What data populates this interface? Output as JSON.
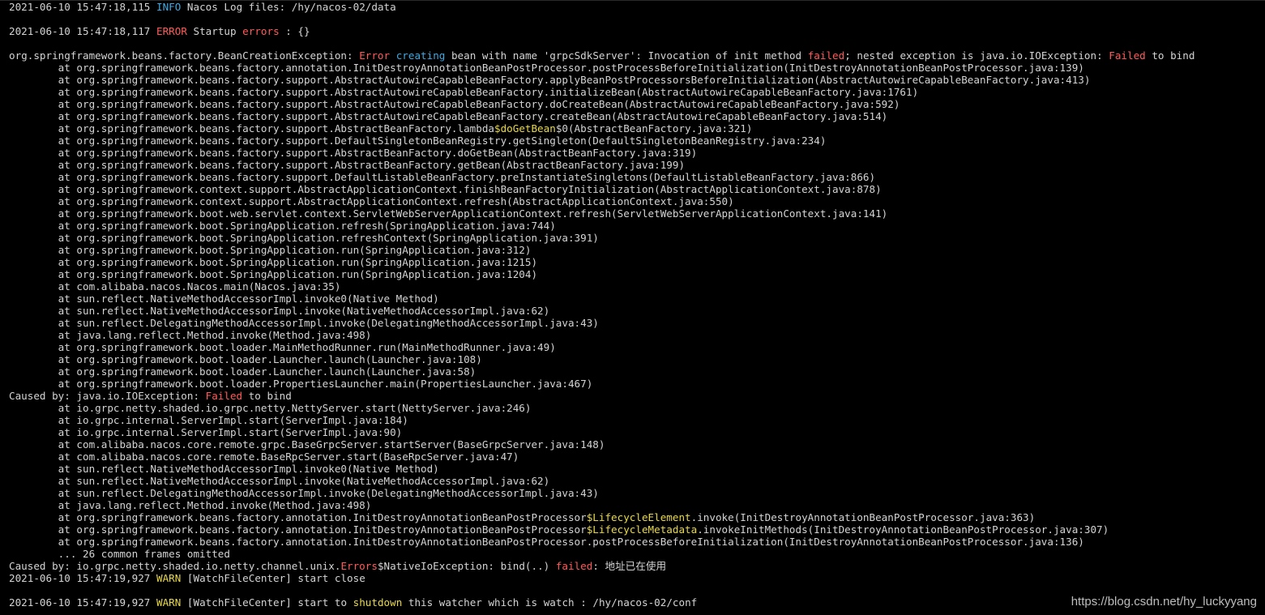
{
  "window": {
    "title": ""
  },
  "colors": {
    "background": "#000000",
    "text": "#d4d4d4",
    "info": "#3fa9e0",
    "error": "#ff5a5a",
    "warn": "#e8d84a"
  },
  "lines": [
    [
      {
        "t": "2021-06-10 15:47:18,115 ",
        "c": "plain"
      },
      {
        "t": "INFO",
        "c": "info"
      },
      {
        "t": " Nacos Log files: /hy/nacos-02/data",
        "c": "plain"
      }
    ],
    [],
    [
      {
        "t": "2021-06-10 15:47:18,117 ",
        "c": "plain"
      },
      {
        "t": "ERROR",
        "c": "error"
      },
      {
        "t": " Startup ",
        "c": "plain"
      },
      {
        "t": "errors",
        "c": "red"
      },
      {
        "t": " : {}",
        "c": "plain"
      }
    ],
    [],
    [
      {
        "t": "org.springframework.beans.factory.BeanCreationException: ",
        "c": "plain"
      },
      {
        "t": "Error",
        "c": "red"
      },
      {
        "t": " ",
        "c": "plain"
      },
      {
        "t": "creating",
        "c": "blue"
      },
      {
        "t": " bean with name 'grpcSdkServer': Invocation of init method ",
        "c": "plain"
      },
      {
        "t": "failed",
        "c": "red"
      },
      {
        "t": "; nested exception is java.io.IOException: ",
        "c": "plain"
      },
      {
        "t": "Failed",
        "c": "red"
      },
      {
        "t": " to bind",
        "c": "plain"
      }
    ],
    [
      {
        "t": "        at org.springframework.beans.factory.annotation.InitDestroyAnnotationBeanPostProcessor.postProcessBeforeInitialization(InitDestroyAnnotationBeanPostProcessor.java:139)",
        "c": "plain"
      }
    ],
    [
      {
        "t": "        at org.springframework.beans.factory.support.AbstractAutowireCapableBeanFactory.applyBeanPostProcessorsBeforeInitialization(AbstractAutowireCapableBeanFactory.java:413)",
        "c": "plain"
      }
    ],
    [
      {
        "t": "        at org.springframework.beans.factory.support.AbstractAutowireCapableBeanFactory.initializeBean(AbstractAutowireCapableBeanFactory.java:1761)",
        "c": "plain"
      }
    ],
    [
      {
        "t": "        at org.springframework.beans.factory.support.AbstractAutowireCapableBeanFactory.doCreateBean(AbstractAutowireCapableBeanFactory.java:592)",
        "c": "plain"
      }
    ],
    [
      {
        "t": "        at org.springframework.beans.factory.support.AbstractAutowireCapableBeanFactory.createBean(AbstractAutowireCapableBeanFactory.java:514)",
        "c": "plain"
      }
    ],
    [
      {
        "t": "        at org.springframework.beans.factory.support.AbstractBeanFactory.lambda",
        "c": "plain"
      },
      {
        "t": "$doGetBean",
        "c": "yellow"
      },
      {
        "t": "$0(AbstractBeanFactory.java:321)",
        "c": "plain"
      }
    ],
    [
      {
        "t": "        at org.springframework.beans.factory.support.DefaultSingletonBeanRegistry.getSingleton(DefaultSingletonBeanRegistry.java:234)",
        "c": "plain"
      }
    ],
    [
      {
        "t": "        at org.springframework.beans.factory.support.AbstractBeanFactory.doGetBean(AbstractBeanFactory.java:319)",
        "c": "plain"
      }
    ],
    [
      {
        "t": "        at org.springframework.beans.factory.support.AbstractBeanFactory.getBean(AbstractBeanFactory.java:199)",
        "c": "plain"
      }
    ],
    [
      {
        "t": "        at org.springframework.beans.factory.support.DefaultListableBeanFactory.preInstantiateSingletons(DefaultListableBeanFactory.java:866)",
        "c": "plain"
      }
    ],
    [
      {
        "t": "        at org.springframework.context.support.AbstractApplicationContext.finishBeanFactoryInitialization(AbstractApplicationContext.java:878)",
        "c": "plain"
      }
    ],
    [
      {
        "t": "        at org.springframework.context.support.AbstractApplicationContext.refresh(AbstractApplicationContext.java:550)",
        "c": "plain"
      }
    ],
    [
      {
        "t": "        at org.springframework.boot.web.servlet.context.ServletWebServerApplicationContext.refresh(ServletWebServerApplicationContext.java:141)",
        "c": "plain"
      }
    ],
    [
      {
        "t": "        at org.springframework.boot.SpringApplication.refresh(SpringApplication.java:744)",
        "c": "plain"
      }
    ],
    [
      {
        "t": "        at org.springframework.boot.SpringApplication.refreshContext(SpringApplication.java:391)",
        "c": "plain"
      }
    ],
    [
      {
        "t": "        at org.springframework.boot.SpringApplication.run(SpringApplication.java:312)",
        "c": "plain"
      }
    ],
    [
      {
        "t": "        at org.springframework.boot.SpringApplication.run(SpringApplication.java:1215)",
        "c": "plain"
      }
    ],
    [
      {
        "t": "        at org.springframework.boot.SpringApplication.run(SpringApplication.java:1204)",
        "c": "plain"
      }
    ],
    [
      {
        "t": "        at com.alibaba.nacos.Nacos.main(Nacos.java:35)",
        "c": "plain"
      }
    ],
    [
      {
        "t": "        at sun.reflect.NativeMethodAccessorImpl.invoke0(Native Method)",
        "c": "plain"
      }
    ],
    [
      {
        "t": "        at sun.reflect.NativeMethodAccessorImpl.invoke(NativeMethodAccessorImpl.java:62)",
        "c": "plain"
      }
    ],
    [
      {
        "t": "        at sun.reflect.DelegatingMethodAccessorImpl.invoke(DelegatingMethodAccessorImpl.java:43)",
        "c": "plain"
      }
    ],
    [
      {
        "t": "        at java.lang.reflect.Method.invoke(Method.java:498)",
        "c": "plain"
      }
    ],
    [
      {
        "t": "        at org.springframework.boot.loader.MainMethodRunner.run(MainMethodRunner.java:49)",
        "c": "plain"
      }
    ],
    [
      {
        "t": "        at org.springframework.boot.loader.Launcher.launch(Launcher.java:108)",
        "c": "plain"
      }
    ],
    [
      {
        "t": "        at org.springframework.boot.loader.Launcher.launch(Launcher.java:58)",
        "c": "plain"
      }
    ],
    [
      {
        "t": "        at org.springframework.boot.loader.PropertiesLauncher.main(PropertiesLauncher.java:467)",
        "c": "plain"
      }
    ],
    [
      {
        "t": "Caused by: java.io.IOException: ",
        "c": "plain"
      },
      {
        "t": "Failed",
        "c": "red"
      },
      {
        "t": " to bind",
        "c": "plain"
      }
    ],
    [
      {
        "t": "        at io.grpc.netty.shaded.io.grpc.netty.NettyServer.start(NettyServer.java:246)",
        "c": "plain"
      }
    ],
    [
      {
        "t": "        at io.grpc.internal.ServerImpl.start(ServerImpl.java:184)",
        "c": "plain"
      }
    ],
    [
      {
        "t": "        at io.grpc.internal.ServerImpl.start(ServerImpl.java:90)",
        "c": "plain"
      }
    ],
    [
      {
        "t": "        at com.alibaba.nacos.core.remote.grpc.BaseGrpcServer.startServer(BaseGrpcServer.java:148)",
        "c": "plain"
      }
    ],
    [
      {
        "t": "        at com.alibaba.nacos.core.remote.BaseRpcServer.start(BaseRpcServer.java:47)",
        "c": "plain"
      }
    ],
    [
      {
        "t": "        at sun.reflect.NativeMethodAccessorImpl.invoke0(Native Method)",
        "c": "plain"
      }
    ],
    [
      {
        "t": "        at sun.reflect.NativeMethodAccessorImpl.invoke(NativeMethodAccessorImpl.java:62)",
        "c": "plain"
      }
    ],
    [
      {
        "t": "        at sun.reflect.DelegatingMethodAccessorImpl.invoke(DelegatingMethodAccessorImpl.java:43)",
        "c": "plain"
      }
    ],
    [
      {
        "t": "        at java.lang.reflect.Method.invoke(Method.java:498)",
        "c": "plain"
      }
    ],
    [
      {
        "t": "        at org.springframework.beans.factory.annotation.InitDestroyAnnotationBeanPostProcessor",
        "c": "plain"
      },
      {
        "t": "$LifecycleElement",
        "c": "yellow"
      },
      {
        "t": ".invoke(InitDestroyAnnotationBeanPostProcessor.java:363)",
        "c": "plain"
      }
    ],
    [
      {
        "t": "        at org.springframework.beans.factory.annotation.InitDestroyAnnotationBeanPostProcessor",
        "c": "plain"
      },
      {
        "t": "$LifecycleMetadata",
        "c": "yellow"
      },
      {
        "t": ".invokeInitMethods(InitDestroyAnnotationBeanPostProcessor.java:307)",
        "c": "plain"
      }
    ],
    [
      {
        "t": "        at org.springframework.beans.factory.annotation.InitDestroyAnnotationBeanPostProcessor.postProcessBeforeInitialization(InitDestroyAnnotationBeanPostProcessor.java:136)",
        "c": "plain"
      }
    ],
    [
      {
        "t": "        ... 26 common frames omitted",
        "c": "plain"
      }
    ],
    [
      {
        "t": "Caused by: io.grpc.netty.shaded.io.netty.channel.unix.",
        "c": "plain"
      },
      {
        "t": "Errors",
        "c": "red"
      },
      {
        "t": "$NativeIoException: bind(..) ",
        "c": "plain"
      },
      {
        "t": "failed",
        "c": "red"
      },
      {
        "t": ": 地址已在使用",
        "c": "plain"
      }
    ],
    [
      {
        "t": "2021-06-10 15:47:19,927 ",
        "c": "plain"
      },
      {
        "t": "WARN",
        "c": "warn"
      },
      {
        "t": " [WatchFileCenter] start close",
        "c": "plain"
      }
    ],
    [],
    [
      {
        "t": "2021-06-10 15:47:19,927 ",
        "c": "plain"
      },
      {
        "t": "WARN",
        "c": "warn"
      },
      {
        "t": " [WatchFileCenter] start to ",
        "c": "plain"
      },
      {
        "t": "shutdown",
        "c": "yellow"
      },
      {
        "t": " this watcher which is watch : /hy/nacos-02/conf",
        "c": "plain"
      }
    ]
  ],
  "watermark": "https://blog.csdn.net/hy_luckyyang"
}
